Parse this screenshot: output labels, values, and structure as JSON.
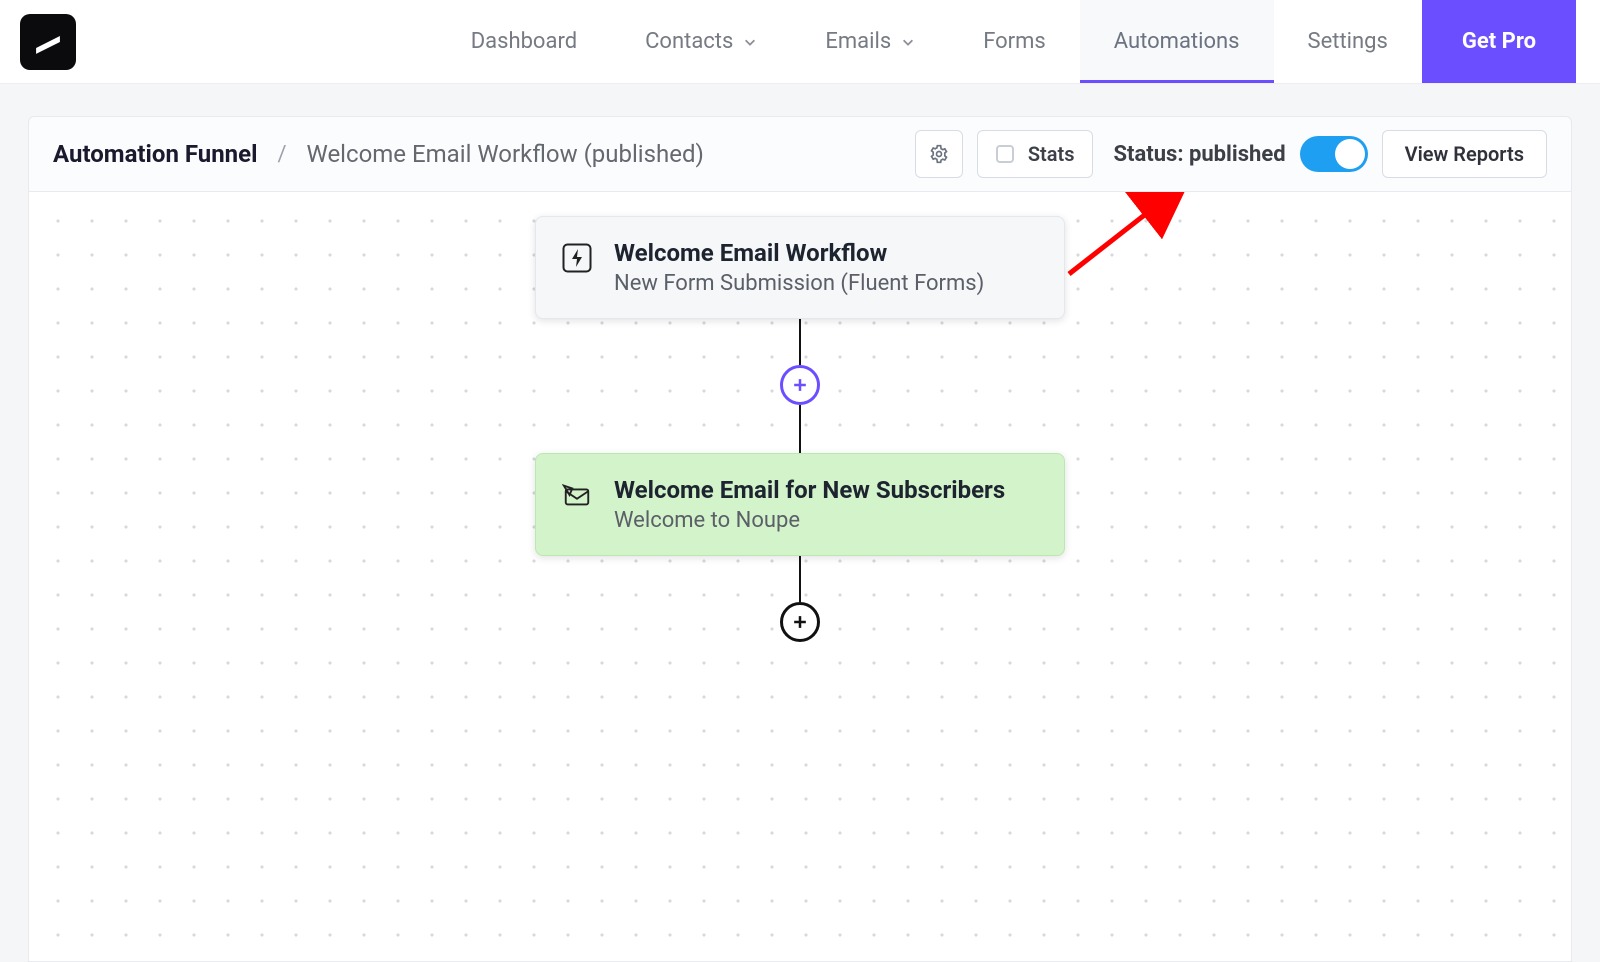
{
  "nav": {
    "items": [
      {
        "label": "Dashboard",
        "dropdown": false,
        "active": false
      },
      {
        "label": "Contacts",
        "dropdown": true,
        "active": false
      },
      {
        "label": "Emails",
        "dropdown": true,
        "active": false
      },
      {
        "label": "Forms",
        "dropdown": false,
        "active": false
      },
      {
        "label": "Automations",
        "dropdown": false,
        "active": true
      },
      {
        "label": "Settings",
        "dropdown": false,
        "active": false
      }
    ],
    "cta": "Get Pro"
  },
  "subheader": {
    "breadcrumb_root": "Automation Funnel",
    "funnel_name": "Welcome Email Workflow (published)",
    "stats_label": "Stats",
    "status_prefix": "Status: ",
    "status_value": "published",
    "toggle_on": true,
    "view_reports": "View Reports"
  },
  "flow": {
    "trigger": {
      "title": "Welcome Email Workflow",
      "subtitle": "New Form Submission (Fluent Forms)"
    },
    "action1": {
      "title": "Welcome Email for New Subscribers",
      "subtitle": "Welcome to Noupe"
    }
  },
  "colors": {
    "accent": "#6b4eff",
    "toggle_on": "#1e9ff2",
    "action_bg": "#d3f3ca",
    "annotation_arrow": "#ff0000"
  }
}
